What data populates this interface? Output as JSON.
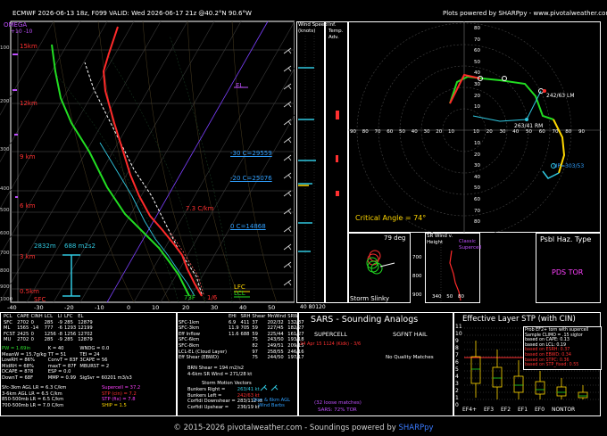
{
  "header": {
    "title": "ECMWF 2026-06-13 18z, F099  VALID: Wed 2026-06-17 21z @40.2°N 90.6°W",
    "credit": "Plots powered by SHARPpy - www.pivotalweather.com"
  },
  "skewt": {
    "omega": "OMEGA",
    "omega_ticks": "+10   -10",
    "height_labels": [
      "15km",
      "12km",
      "9 km",
      "6 km",
      "3 km",
      "0.5km",
      "SFC"
    ],
    "pressure_labels": [
      "100",
      "200",
      "300",
      "400",
      "500",
      "600",
      "700",
      "800",
      "900",
      "1000"
    ],
    "temp_labels": [
      "-40",
      "-30",
      "-20",
      "-10",
      "0",
      "10",
      "20",
      "30",
      "40",
      "50"
    ],
    "el": "EL",
    "lfc": "LFC",
    "lcl": "LCL",
    "lapse": "7.3 C/km",
    "c_labels": [
      "-30 C=29559",
      "-20 C=25076",
      "0 C=14868"
    ],
    "sfc_temp": "73F",
    "sfc_td": "1/6",
    "helicity_height": "2832m",
    "helicity_value": "688 m2s2"
  },
  "wind_speed": {
    "title": "Wind Speed",
    "units": "(knots)",
    "ticks": [
      "40",
      "80",
      "120"
    ]
  },
  "inferred": {
    "title": "Inf. Temp. Adv."
  },
  "hodograph": {
    "x_ticks": [
      "90",
      "80",
      "70",
      "60",
      "50",
      "40",
      "30",
      "20",
      "10"
    ],
    "x_ticks_right": [
      "10",
      "20",
      "30",
      "40",
      "50",
      "60",
      "70",
      "80",
      "90"
    ],
    "y_ticks_top": [
      "80",
      "70",
      "60",
      "50",
      "40",
      "30",
      "20",
      "10"
    ],
    "y_ticks_bottom": [
      "10",
      "20",
      "30",
      "40",
      "50",
      "60",
      "70",
      "80"
    ],
    "lm": "242/63 LM",
    "rm": "263/41 RM",
    "up": "UP=303/53",
    "critical_angle": "Critical Angle = 74°"
  },
  "mini_panels": {
    "storm_slinky": "Storm Slinky",
    "slinky_deg": "79 deg",
    "slinky_pressures": [
      "700",
      "800",
      "900"
    ],
    "srw_title": "SR Wind v. Height",
    "srw_ticks": [
      "340",
      "50",
      "80"
    ],
    "srw_label": "Classic Supercell",
    "hazard_title": "Psbl Haz. Type",
    "hazard_value": "PDS TOR"
  },
  "thermo_table": {
    "columns": [
      "PCL",
      "CAPE",
      "CINH",
      "LCL",
      "LI",
      "LFC",
      "EL"
    ],
    "rows": [
      [
        "SFC",
        "2702",
        "0",
        "285",
        "-9",
        "285",
        "12879"
      ],
      [
        "ML",
        "1565",
        "-14",
        "777",
        "-6",
        "1293",
        "12199"
      ],
      [
        "FCST",
        "2425",
        "0",
        "1256",
        "-8",
        "1256",
        "12702"
      ],
      [
        "MU",
        "2702",
        "0",
        "285",
        "-9",
        "285",
        "12879"
      ]
    ],
    "extra": [
      [
        "PW = 1.69in",
        "K = 40",
        "WNDG = 0.0"
      ],
      [
        "MeanW = 15.7g/kg",
        "TT = 51",
        "TEI = 24"
      ],
      [
        "LowRH = 86%",
        "ConvT = 83F",
        "3CAPE = 56"
      ],
      [
        "MidRH = 68%",
        "maxT = 87F",
        "MBURST = 2"
      ],
      [
        "DCAPE = 878",
        "ESP = 0.0",
        ""
      ],
      [
        "DownT = 68F",
        "MMP = 0.99",
        "SigSvr = 60201 m3/s3"
      ]
    ],
    "lapse": [
      "Sfc-3km AGL LR = 6.3 C/km",
      "3-6km AGL LR = 6.5 C/km",
      "850-500mb LR = 6.5 C/km",
      "700-500mb LR = 7.0 C/km"
    ],
    "params": [
      "Supercell = 37.2",
      "STP (cin) = 7.2",
      "STP (fix) = 7.8",
      "SHIP = 1.5"
    ]
  },
  "kinematic_table": {
    "columns": [
      "",
      "EHI",
      "SRH",
      "Shear",
      "MnWind",
      "SRW"
    ],
    "rows": [
      [
        "SFC-1km",
        "6.9",
        "411",
        "37",
        "202/32",
        "132/37"
      ],
      [
        "SFC-3km",
        "11.9",
        "705",
        "59",
        "227/45",
        "182/27"
      ],
      [
        "Eff Inflow",
        "11.6",
        "688",
        "59",
        "225/44",
        "161/27"
      ],
      [
        "SFC-6km",
        "",
        "",
        "75",
        "243/50",
        "193/18"
      ],
      [
        "SFC-8km",
        "",
        "",
        "82",
        "249/51",
        "209/15"
      ],
      [
        "LCL-EL (Cloud Layer)",
        "",
        "",
        "97",
        "258/55",
        "246/16"
      ],
      [
        "Eff Shear (EBWD)",
        "",
        "",
        "75",
        "244/50",
        "197/17"
      ]
    ],
    "brn": "BRN Shear = 194 m2/s2",
    "mean_srw": "4-6km SR Wind = 271/28 kt",
    "vectors_title": "Storm Motion Vectors",
    "vectors": [
      [
        "Bunkers Right =",
        "263/41 kt"
      ],
      [
        "Bunkers Left =",
        "242/63 kt"
      ],
      [
        "Corfidi Downshear =",
        "283/112 kt"
      ],
      [
        "Corfidi Upshear =",
        "236/19 kt"
      ]
    ],
    "mini_hodo_label": "1km & 6km AGL Wind Barbs"
  },
  "sars": {
    "title": "SARS - Sounding Analogs",
    "supercell": "SUPERCELL",
    "hail": "SGFNT HAIL",
    "match": "24 Apr 15 1124 (Kidk) - 3/6",
    "no_matches": "No Quality Matches",
    "loose": "(32 loose matches)",
    "tor_prob": "SARS: 72% TOR"
  },
  "stp": {
    "title": "Effective Layer STP (with CIN)",
    "y_ticks": [
      "11",
      "10",
      "9",
      "8",
      "7",
      "6",
      "5",
      "4",
      "3",
      "2",
      "1",
      "0"
    ],
    "categories": [
      "EF4+",
      "EF3",
      "EF2",
      "EF1",
      "EF0",
      "NONTOR"
    ],
    "legend": [
      {
        "text": "Prob EF2+ torn with supercell",
        "color": "#ffffff"
      },
      {
        "text": "Sample CLIMO = .15 sigtor",
        "color": "#ffffff"
      },
      {
        "text": "based on CAPE: 0.13",
        "color": "#ffffff"
      },
      {
        "text": "based on LCL: 0.19",
        "color": "#ffffff"
      },
      {
        "text": "based on ESRH: 0.37",
        "color": "#ff3030"
      },
      {
        "text": "based on EBWD: 0.34",
        "color": "#ff3030"
      },
      {
        "text": "based on STPC: 0.36",
        "color": "#ff3030"
      },
      {
        "text": "based on STP_fixed: 0.55",
        "color": "#ff3030"
      }
    ]
  },
  "footer": {
    "text": "© 2015-2026 pivotalweather.com - Soundings powered by",
    "link": "SHARPpy"
  }
}
